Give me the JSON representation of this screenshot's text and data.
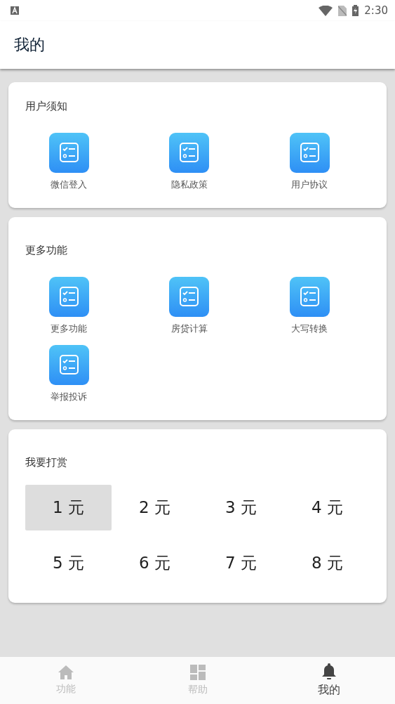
{
  "status_bar": {
    "time": "2:30"
  },
  "app_bar": {
    "title": "我的"
  },
  "sections": [
    {
      "title": "用户须知",
      "items": [
        "微信登入",
        "隐私政策",
        "用户协议"
      ]
    },
    {
      "title": "更多功能",
      "items": [
        "更多功能",
        "房贷计算",
        "大写转换",
        "举报投诉"
      ]
    }
  ],
  "reward": {
    "title": "我要打赏",
    "amounts": [
      {
        "label": "1 元",
        "selected": true
      },
      {
        "label": "2 元",
        "selected": false
      },
      {
        "label": "3 元",
        "selected": false
      },
      {
        "label": "4 元",
        "selected": false
      },
      {
        "label": "5 元",
        "selected": false
      },
      {
        "label": "6 元",
        "selected": false
      },
      {
        "label": "7 元",
        "selected": false
      },
      {
        "label": "8 元",
        "selected": false
      }
    ]
  },
  "bottom_nav": [
    {
      "kind": "home",
      "label": "功能",
      "selected": false
    },
    {
      "kind": "dashboard",
      "label": "帮助",
      "selected": false
    },
    {
      "kind": "bell",
      "label": "我的",
      "selected": true
    }
  ]
}
